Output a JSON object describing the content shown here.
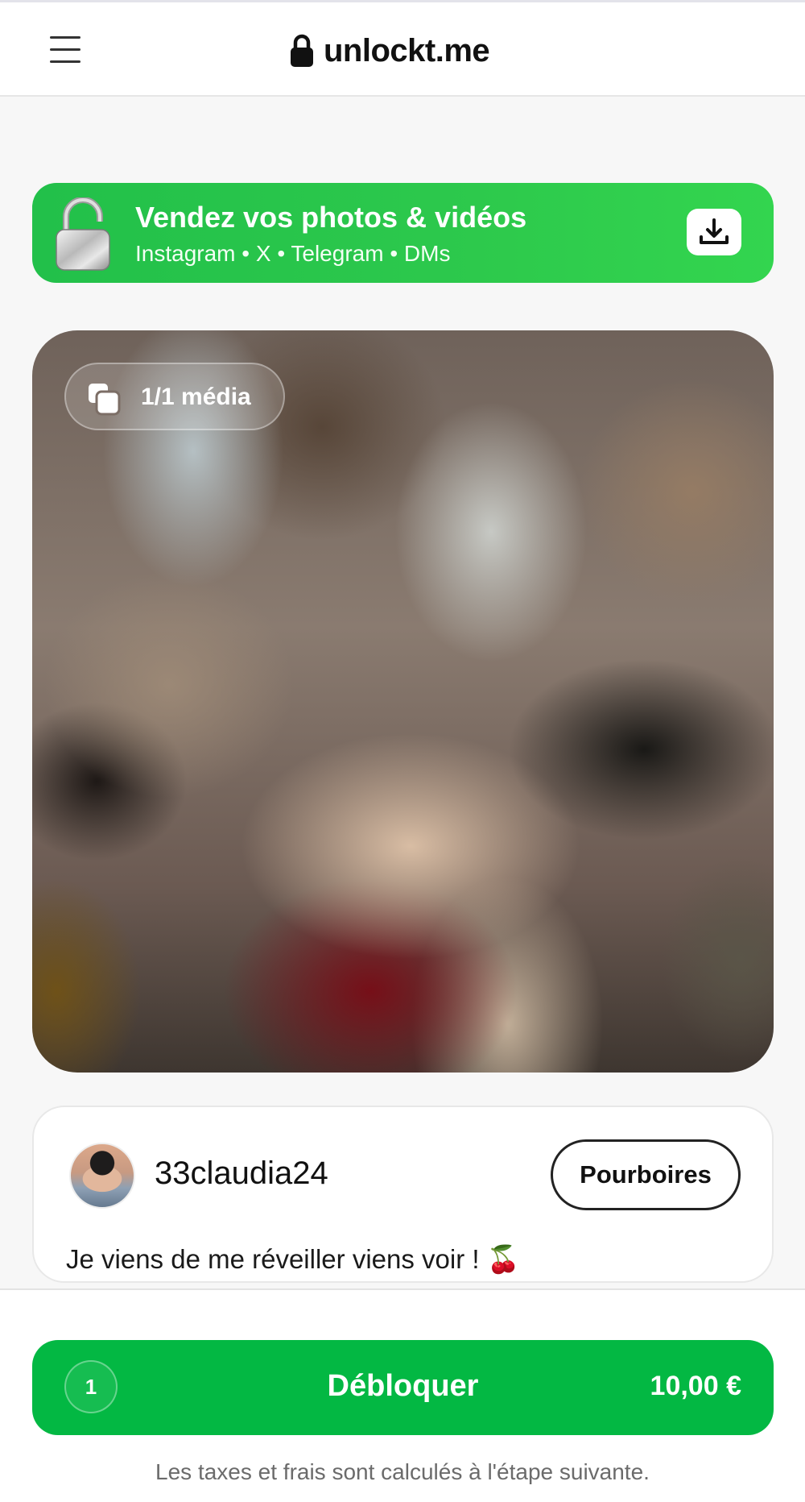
{
  "header": {
    "brand": "unlockt.me",
    "icons": {
      "menu": "hamburger-menu-icon",
      "brand": "lock-icon"
    }
  },
  "promo": {
    "title": "Vendez vos photos & vidéos",
    "subtitle": "Instagram • X • Telegram • DMs",
    "icons": {
      "lock": "open-padlock-icon",
      "action": "download-icon"
    },
    "color": "#2dc94c"
  },
  "media": {
    "badge": "1/1 média",
    "badge_icon": "media-stack-icon"
  },
  "post": {
    "username": "33claudia24",
    "tips_label": "Pourboires",
    "caption": "Je viens de me réveiller viens voir ! 🍒"
  },
  "purchase": {
    "count": "1",
    "label": "Débloquer",
    "price": "10,00 €",
    "color": "#03b843",
    "tax_note": "Les taxes et frais sont calculés à l'étape suivante."
  }
}
